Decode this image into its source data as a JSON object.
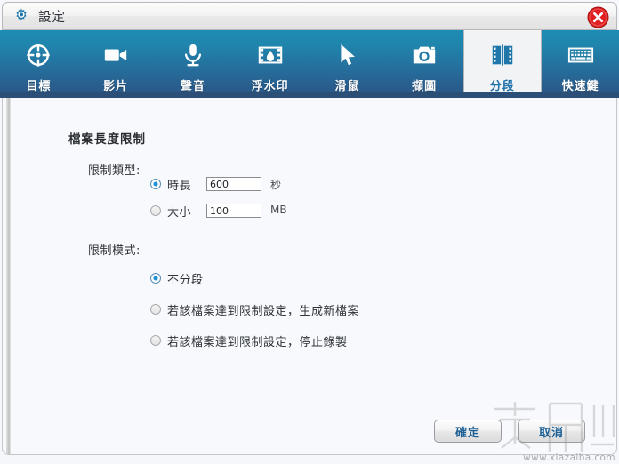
{
  "window": {
    "title": "設定",
    "gear_icon": "gear-icon",
    "close_icon": "close-icon"
  },
  "tabs": [
    {
      "label": "目標",
      "icon": "target-icon",
      "active": false
    },
    {
      "label": "影片",
      "icon": "video-camera-icon",
      "active": false
    },
    {
      "label": "聲音",
      "icon": "microphone-icon",
      "active": false
    },
    {
      "label": "浮水印",
      "icon": "watermark-film-icon",
      "active": false
    },
    {
      "label": "滑鼠",
      "icon": "cursor-arrow-icon",
      "active": false
    },
    {
      "label": "擷圖",
      "icon": "camera-icon",
      "active": false
    },
    {
      "label": "分段",
      "icon": "film-split-icon",
      "active": true
    },
    {
      "label": "快速鍵",
      "icon": "keyboard-icon",
      "active": false
    }
  ],
  "form": {
    "group_title": "檔案長度限制",
    "limit_type_label": "限制類型:",
    "limit_mode_label": "限制模式:",
    "limit_type_options": [
      {
        "label": "時長",
        "selected": true,
        "value": "600",
        "unit": "秒"
      },
      {
        "label": "大小",
        "selected": false,
        "value": "100",
        "unit": "MB"
      }
    ],
    "limit_mode_options": [
      {
        "label": "不分段",
        "selected": true
      },
      {
        "label": "若該檔案達到限制設定，生成新檔案",
        "selected": false
      },
      {
        "label": "若該檔案達到限制設定，停止錄製",
        "selected": false
      }
    ]
  },
  "footer": {
    "ok_label": "確定",
    "cancel_label": "取消"
  },
  "watermark": {
    "logo_text": "下载吧",
    "url_text": "www.xiazaiba.com"
  },
  "colors": {
    "tab_top": "#1d8cb4",
    "tab_bottom": "#2a5585",
    "navy_bar": "#2c4f78",
    "active_tab_text": "#1c6fa8",
    "button_text": "#1a5f95",
    "radio_on": "#1f8fd6",
    "close_red": "#e02020",
    "content_bg": "#f7f9fc"
  }
}
